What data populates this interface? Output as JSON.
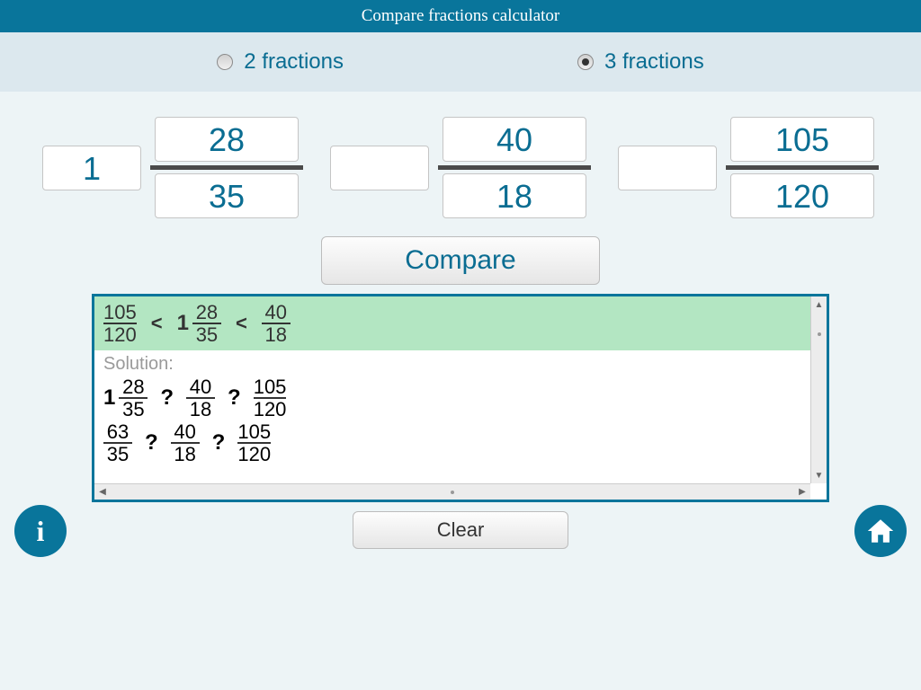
{
  "title": "Compare fractions calculator",
  "radios": {
    "two_label": "2 fractions",
    "three_label": "3 fractions",
    "selected": "3"
  },
  "inputs": [
    {
      "whole": "1",
      "num": "28",
      "den": "35"
    },
    {
      "whole": "",
      "num": "40",
      "den": "18"
    },
    {
      "whole": "",
      "num": "105",
      "den": "120"
    }
  ],
  "buttons": {
    "compare": "Compare",
    "clear": "Clear"
  },
  "result": {
    "ordered": [
      {
        "whole": "",
        "num": "105",
        "den": "120"
      },
      {
        "whole": "1",
        "num": "28",
        "den": "35"
      },
      {
        "whole": "",
        "num": "40",
        "den": "18"
      }
    ],
    "relation": "<",
    "solution_label": "Solution:",
    "steps": [
      [
        {
          "whole": "1",
          "num": "28",
          "den": "35"
        },
        {
          "whole": "",
          "num": "40",
          "den": "18"
        },
        {
          "whole": "",
          "num": "105",
          "den": "120"
        }
      ],
      [
        {
          "whole": "",
          "num": "63",
          "den": "35"
        },
        {
          "whole": "",
          "num": "40",
          "den": "18"
        },
        {
          "whole": "",
          "num": "105",
          "den": "120"
        }
      ]
    ],
    "step_separator": "?"
  },
  "icons": {
    "info": "i",
    "home": "home-icon"
  }
}
